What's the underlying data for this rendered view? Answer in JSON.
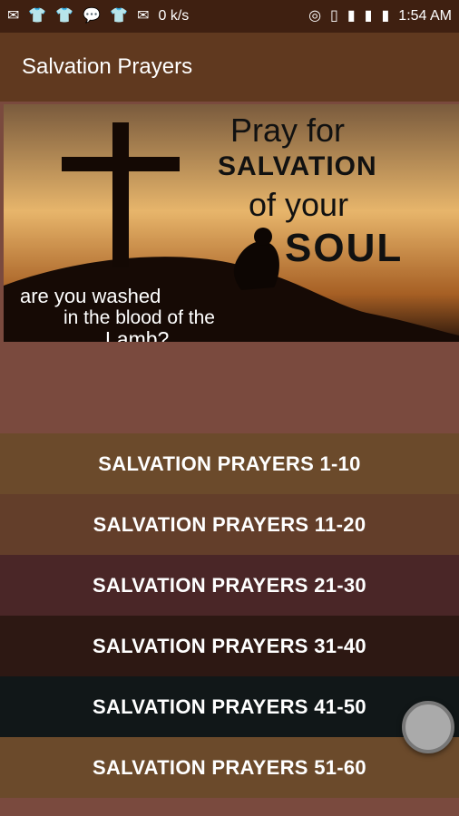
{
  "status_bar": {
    "network_speed": "0 k/s",
    "time": "1:54 AM",
    "icons_left": [
      "message-icon",
      "shirt-icon",
      "shirt-icon",
      "chat-icon",
      "shirt-icon",
      "mail-icon"
    ],
    "icons_right": [
      "hotspot-icon",
      "vibrate-icon",
      "signal-icon",
      "signal-icon",
      "battery-icon"
    ]
  },
  "app_bar": {
    "title": "Salvation Prayers"
  },
  "hero": {
    "line1": "Pray for",
    "line2": "SALVATION",
    "line3": "of your",
    "line4": "SOUL",
    "question_line1": "are you washed",
    "question_line2": "in the blood of the",
    "question_line3": "Lamb?"
  },
  "menu": {
    "items": [
      {
        "label": "SALVATION PRAYERS 1-10",
        "color": "#6b4a2b"
      },
      {
        "label": "SALVATION PRAYERS 11-20",
        "color": "#633e2a"
      },
      {
        "label": "SALVATION PRAYERS 21-30",
        "color": "#4a2627"
      },
      {
        "label": "SALVATION PRAYERS 31-40",
        "color": "#2d1813"
      },
      {
        "label": "SALVATION PRAYERS 41-50",
        "color": "#111718"
      },
      {
        "label": "SALVATION PRAYERS 51-60",
        "color": "#6b4a2b"
      }
    ]
  },
  "colors": {
    "status_bar": "#3f2011",
    "app_bar": "#60391f",
    "background": "#7a4a3e"
  }
}
